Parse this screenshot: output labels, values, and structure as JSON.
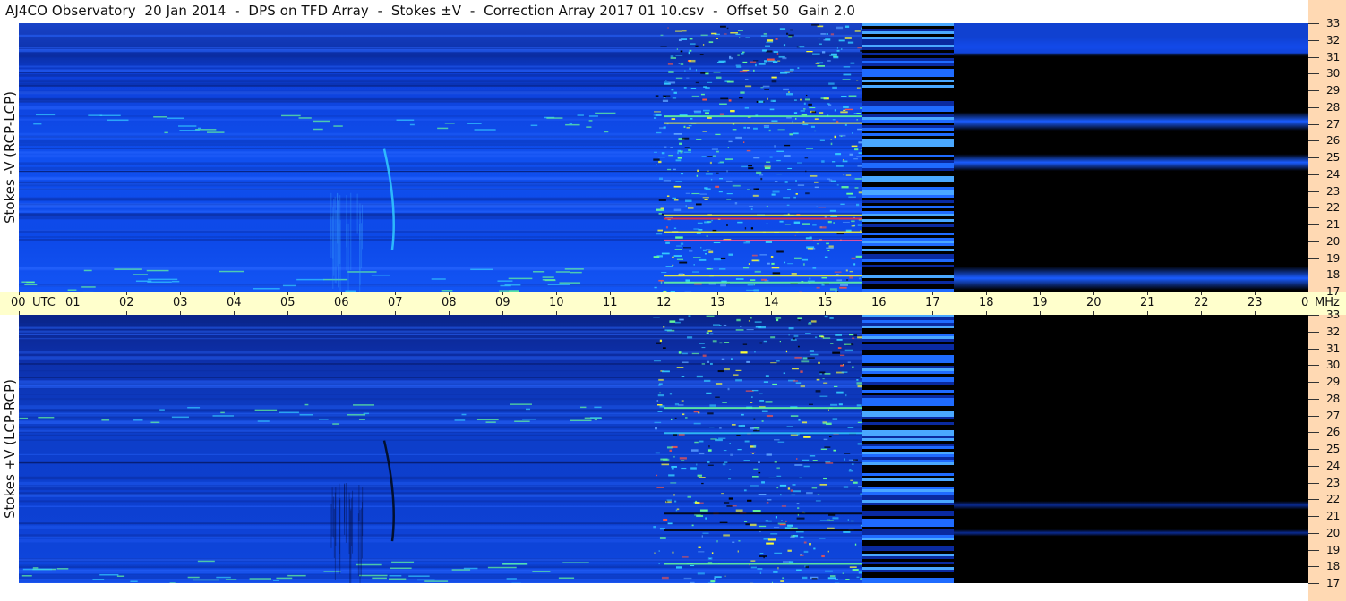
{
  "title": "AJ4CO Observatory  20 Jan 2014  -  DPS on TFD Array  -  Stokes ±V  -  Correction Array 2017 01 10.csv  -  Offset 50  Gain 2.0",
  "chart_data": {
    "type": "heatmap",
    "x_axis": {
      "label": "UTC",
      "ticks": [
        "00",
        "01",
        "02",
        "03",
        "04",
        "05",
        "06",
        "07",
        "08",
        "09",
        "10",
        "11",
        "12",
        "13",
        "14",
        "15",
        "16",
        "17",
        "18",
        "19",
        "20",
        "21",
        "22",
        "23",
        "00"
      ],
      "range_hours": [
        0,
        24
      ],
      "data_coverage_hours": [
        0,
        17.4
      ]
    },
    "y_axis": {
      "unit": "MHz",
      "range": [
        17,
        33
      ],
      "ticks": [
        17,
        18,
        19,
        20,
        21,
        22,
        23,
        24,
        25,
        26,
        27,
        28,
        29,
        30,
        31,
        32,
        33
      ]
    },
    "panels": [
      {
        "id": "top",
        "ylabel": "Stokes -V (RCP-LCP)"
      },
      {
        "id": "bottom",
        "ylabel": "Stokes +V (LCP-RCP)"
      }
    ],
    "colormap": [
      "#000000",
      "#001a80",
      "#0033cc",
      "#0066ff",
      "#33ccff",
      "#66ff99",
      "#ffff33",
      "#ff3333"
    ]
  }
}
